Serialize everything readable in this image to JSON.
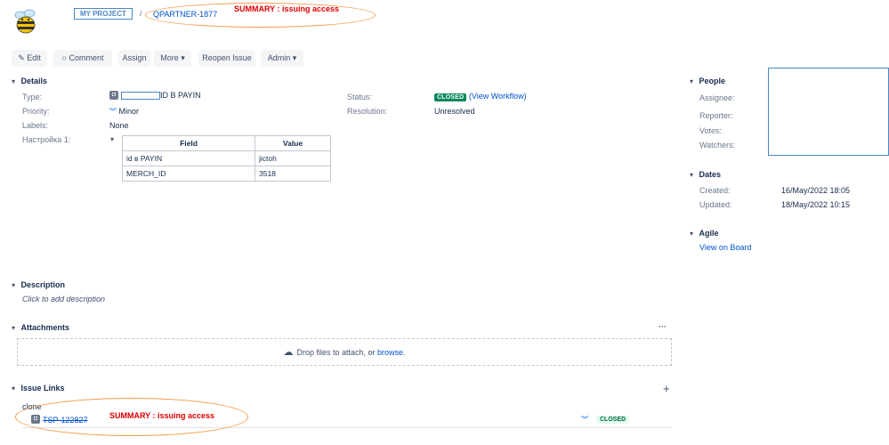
{
  "header": {
    "project": "MY PROJECT",
    "separator": "/",
    "issue_key": "QPARTNER-1877",
    "annotation": "SUMMARY : issuing access"
  },
  "toolbar": {
    "edit": "Edit",
    "comment": "Comment",
    "assign": "Assign",
    "more": "More",
    "reopen": "Reopen Issue",
    "admin": "Admin"
  },
  "details": {
    "title": "Details",
    "type_label": "Type:",
    "type_value": "ID B PAYIN",
    "priority_label": "Priority:",
    "priority_value": "Minor",
    "labels_label": "Labels:",
    "labels_value": "None",
    "custom_label": "Настройка 1:",
    "status_label": "Status:",
    "status_value": "CLOSED",
    "workflow_link": "(View Workflow)",
    "resolution_label": "Resolution:",
    "resolution_value": "Unresolved",
    "table": {
      "headers": [
        "Field",
        "Value"
      ],
      "rows": [
        [
          "id в PAYIN",
          "jictoh"
        ],
        [
          "MERCH_ID",
          "3518"
        ]
      ]
    }
  },
  "people": {
    "title": "People",
    "assignee_label": "Assignee:",
    "reporter_label": "Reporter:",
    "votes_label": "Votes:",
    "watchers_label": "Watchers:"
  },
  "dates": {
    "title": "Dates",
    "created_label": "Created:",
    "created_value": "16/May/2022 18:05",
    "updated_label": "Updated:",
    "updated_value": "18/May/2022 10:15"
  },
  "agile": {
    "title": "Agile",
    "view_on_board": "View on Board"
  },
  "description": {
    "title": "Description",
    "placeholder": "Click to add description"
  },
  "attachments": {
    "title": "Attachments",
    "more": "···",
    "drop_text": "Drop files to attach, or",
    "browse": "browse",
    "period": "."
  },
  "issue_links": {
    "title": "Issue Links",
    "add": "+",
    "link_type": "clone",
    "linked_key": "TSP-122827",
    "annotation": "SUMMARY : issuing access",
    "status": "CLOSED"
  },
  "colors": {
    "link": "#0052cc",
    "closed": "#00875a",
    "annotation": "#e00000",
    "oval": "#f39c4a"
  }
}
